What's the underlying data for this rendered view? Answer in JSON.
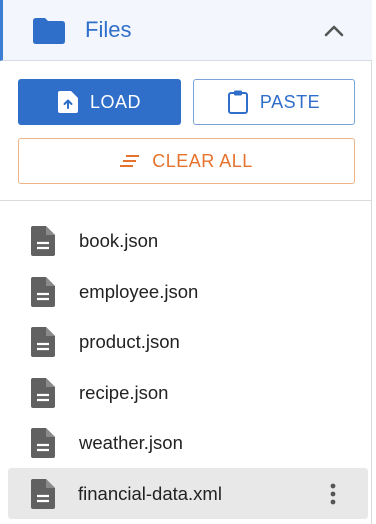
{
  "header": {
    "title": "Files",
    "folder_icon": "folder-icon",
    "toggle_icon": "chevron-up-icon"
  },
  "actions": {
    "load_label": "LOAD",
    "paste_label": "PASTE",
    "clear_label": "CLEAR ALL"
  },
  "files": [
    {
      "name": "book.json"
    },
    {
      "name": "employee.json"
    },
    {
      "name": "product.json"
    },
    {
      "name": "recipe.json"
    },
    {
      "name": "weather.json"
    },
    {
      "name": "financial-data.xml",
      "selected": true
    }
  ],
  "colors": {
    "accent": "#2f6fc9",
    "danger": "#e5732d",
    "selected_bg": "#e8e8e8"
  }
}
